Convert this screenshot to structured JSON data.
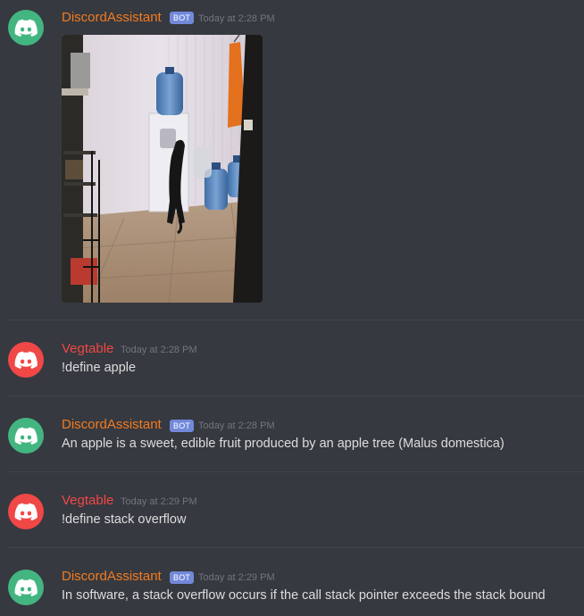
{
  "messages": [
    {
      "author": "DiscordAssistant",
      "author_color": "#f47b20",
      "avatar_color": "#43b581",
      "bot_badge": "BOT",
      "timestamp": "Today at 2:28 PM",
      "text": "",
      "image_alt": "Cat standing on hind legs at a water cooler in a small room"
    },
    {
      "author": "Vegtable",
      "author_color": "#f04747",
      "avatar_color": "#f04747",
      "timestamp": "Today at 2:28 PM",
      "text": "!define apple"
    },
    {
      "author": "DiscordAssistant",
      "author_color": "#f47b20",
      "avatar_color": "#43b581",
      "bot_badge": "BOT",
      "timestamp": "Today at 2:28 PM",
      "text": "An apple is a sweet, edible fruit produced by an apple tree (Malus domestica)"
    },
    {
      "author": "Vegtable",
      "author_color": "#f04747",
      "avatar_color": "#f04747",
      "timestamp": "Today at 2:29 PM",
      "text": "!define stack overflow"
    },
    {
      "author": "DiscordAssistant",
      "author_color": "#f47b20",
      "avatar_color": "#43b581",
      "bot_badge": "BOT",
      "timestamp": "Today at 2:29 PM",
      "text": "In software, a stack overflow occurs if the call stack pointer exceeds the stack bound"
    }
  ]
}
